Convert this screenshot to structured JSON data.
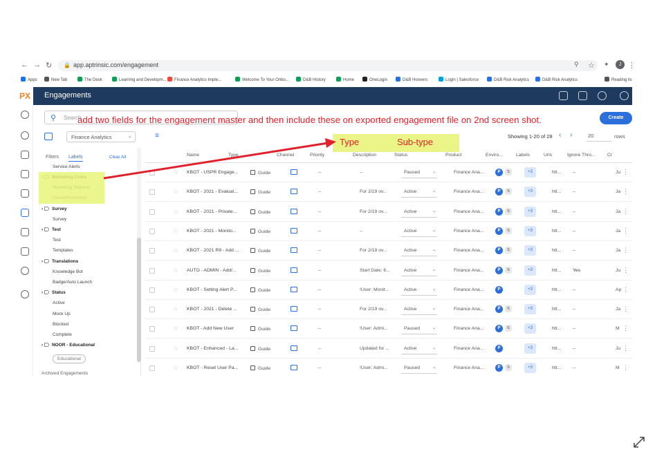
{
  "browser": {
    "url": "app.aptrinsic.com/engagement",
    "bookmarks": [
      "Apps",
      "New Tab",
      "The Desk",
      "Learning and Developm...",
      "Finance Analytics Imple...",
      "Welcome To Your Onbo...",
      "D&B History",
      "Home",
      "OneLogin",
      "D&B Hoovers",
      "Login | Salesforce",
      "D&B Risk Analytics",
      "D&B Risk Analytics",
      "Reading list"
    ],
    "bookmark_colors": [
      "#1a73e8",
      "#555555",
      "#0f9d58",
      "#0f9d58",
      "#e74c3c",
      "#0f9d58",
      "#0f9d58",
      "#0f9d58",
      "#222222",
      "#2a6fdb",
      "#00a1e0",
      "#2a6fdb",
      "#2a6fdb",
      "#555555"
    ],
    "avatar": "J"
  },
  "app": {
    "logo": "PX",
    "title": "Engagements",
    "accent": "#2a6fdb",
    "header_bg": "#1e3a5f"
  },
  "toolbar": {
    "search_placeholder": "Search",
    "create_label": "Create",
    "product_filter": "Finance Analytics",
    "showing": "Showing 1-20 of 28",
    "rows_per_page": "20",
    "rows_label": "rows"
  },
  "filters": {
    "tabs": [
      "Filters",
      "Labels"
    ],
    "clear_all": "Clear All",
    "items": [
      {
        "text": "Service Alerts",
        "group": false
      },
      {
        "text": "Marketing Coms",
        "group": true
      },
      {
        "text": "Marketing Webinar",
        "group": false
      },
      {
        "text": "Upsell/Promotion",
        "group": false
      },
      {
        "text": "Survey",
        "group": true
      },
      {
        "text": "Survey",
        "group": false
      },
      {
        "text": "Test",
        "group": true
      },
      {
        "text": "Test",
        "group": false
      },
      {
        "text": "Templates",
        "group": false
      },
      {
        "text": "Translations",
        "group": true
      },
      {
        "text": "Knowledge Bot",
        "group": false
      },
      {
        "text": "Badge/Auto Launch",
        "group": false
      },
      {
        "text": "Status",
        "group": true
      },
      {
        "text": "Active",
        "group": false
      },
      {
        "text": "Mock Up",
        "group": false
      },
      {
        "text": "Blocked",
        "group": false
      },
      {
        "text": "Complete",
        "group": false
      },
      {
        "text": "NOOR - Educational",
        "group": true
      },
      {
        "text": "Educational",
        "group": false
      }
    ],
    "archived": "Archived Engagements"
  },
  "table": {
    "columns": [
      "Name",
      "Type",
      "Channel",
      "Priority",
      "Description",
      "Status",
      "Product",
      "Enviro...",
      "Labels",
      "Urls",
      "Ignore Thro...",
      "Cr"
    ],
    "rows": [
      {
        "name": "KBOT - USPR Engage...",
        "type": "Guide",
        "priority": "--",
        "description": "--",
        "status": "Paused",
        "product": "Finance Ana...",
        "env": [
          "P",
          "S"
        ],
        "labels": "+3",
        "urls": "htt...",
        "ignore": "--",
        "created": "Ju"
      },
      {
        "name": "KBOT - 2021 - Evaluat...",
        "type": "Guide",
        "priority": "--",
        "description": "For 2/19 ov...",
        "status": "Active",
        "product": "Finance Ana...",
        "env": [
          "P",
          "S"
        ],
        "labels": "+3",
        "urls": "htt...",
        "ignore": "--",
        "created": "Ja"
      },
      {
        "name": "KBOT - 2021 - Private...",
        "type": "Guide",
        "priority": "--",
        "description": "For 2/19 ov...",
        "status": "Active",
        "product": "Finance Ana...",
        "env": [
          "P",
          "S"
        ],
        "labels": "+3",
        "urls": "htt...",
        "ignore": "--",
        "created": "Ja"
      },
      {
        "name": "KBOT - 2021 - Monito...",
        "type": "Guide",
        "priority": "--",
        "description": "--",
        "status": "Active",
        "product": "Finance Ana...",
        "env": [
          "P",
          "S"
        ],
        "labels": "+3",
        "urls": "htt...",
        "ignore": "--",
        "created": "Ja"
      },
      {
        "name": "KBOT - 2021 R9 - Add ...",
        "type": "Guide",
        "priority": "--",
        "description": "For 2/19 ov...",
        "status": "Active",
        "product": "Finance Ana...",
        "env": [
          "P",
          "S"
        ],
        "labels": "+3",
        "urls": "htt...",
        "ignore": "--",
        "created": "Ja"
      },
      {
        "name": "AUTO - ADMIN - Add/...",
        "type": "Guide",
        "priority": "--",
        "description": "Start Date: 6...",
        "status": "Active",
        "product": "Finance Ana...",
        "env": [
          "P",
          "S"
        ],
        "labels": "+3",
        "urls": "htt...",
        "ignore": "Yes",
        "created": "Ju"
      },
      {
        "name": "KBOT - Setting Alert P...",
        "type": "Guide",
        "priority": "--",
        "description": "!User: Monit...",
        "status": "Active",
        "product": "Finance Ana...",
        "env": [
          "P"
        ],
        "labels": "+3",
        "urls": "htt...",
        "ignore": "--",
        "created": "Ap"
      },
      {
        "name": "KBOT - 2021 - Delete ...",
        "type": "Guide",
        "priority": "--",
        "description": "For 2/19 ov...",
        "status": "Active",
        "product": "Finance Ana...",
        "env": [
          "P",
          "S"
        ],
        "labels": "+3",
        "urls": "htt...",
        "ignore": "--",
        "created": "Ja"
      },
      {
        "name": "KBOT - Add New User",
        "type": "Guide",
        "priority": "--",
        "description": "!User: Admi...",
        "status": "Paused",
        "product": "Finance Ana...",
        "env": [
          "P",
          "S"
        ],
        "labels": "+3",
        "urls": "htt...",
        "ignore": "--",
        "created": "M"
      },
      {
        "name": "KBOT - Enhanced - La...",
        "type": "Guide",
        "priority": "--",
        "description": "Updated for ...",
        "status": "Active",
        "product": "Finance Ana...",
        "env": [
          "P"
        ],
        "labels": "+3",
        "urls": "htt...",
        "ignore": "--",
        "created": "Ju"
      },
      {
        "name": "KBOT - Reset User Pa...",
        "type": "Guide",
        "priority": "--",
        "description": "!User: Admi...",
        "status": "Paused",
        "product": "Finance Ana...",
        "env": [
          "P",
          "S"
        ],
        "labels": "+3",
        "urls": "htt...",
        "ignore": "--",
        "created": "M"
      }
    ]
  },
  "annotation": {
    "note": "add two fields for the engagement master and then include these on exported engagement file on 2nd screen shot.",
    "field1": "Type",
    "field2": "Sub-type",
    "color": "#e0202a",
    "highlight": "#e9f47a"
  }
}
